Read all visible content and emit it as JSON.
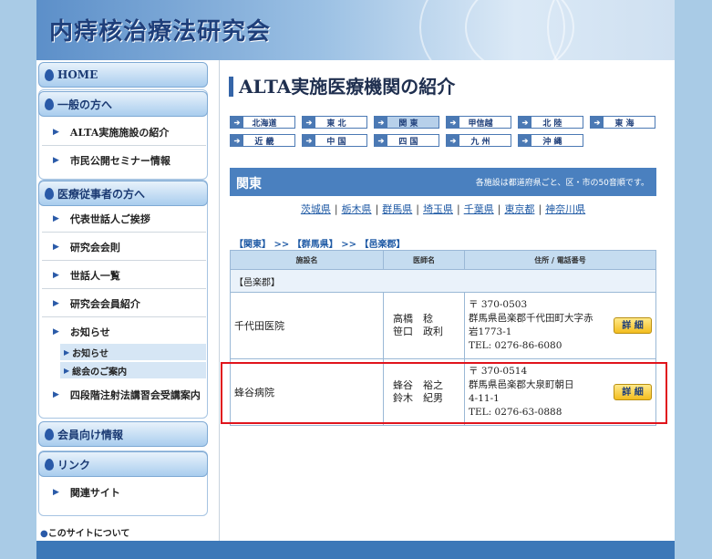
{
  "site": {
    "title": "内痔核治療法研究会"
  },
  "sidebar": {
    "home": "HOME",
    "general_heading": "一般の方へ",
    "general_items": [
      "ALTA実施施設の紹介",
      "市民公開セミナー情報"
    ],
    "medical_heading": "医療従事者の方へ",
    "medical_items": [
      "代表世話人ご挨拶",
      "研究会会則",
      "世話人一覧",
      "研究会会員紹介",
      "お知らせ"
    ],
    "news_sub": [
      "お知らせ",
      "総会のご案内"
    ],
    "medical_last": "四段階注射法講習会受講案内",
    "member_heading": "会員向け情報",
    "link_heading": "リンク",
    "link_items": [
      "関連サイト"
    ],
    "about": "このサイトについて"
  },
  "main": {
    "title": "ALTA実施医療機関の紹介",
    "regions": [
      {
        "label": "北海道",
        "active": false
      },
      {
        "label": "東 北",
        "active": false
      },
      {
        "label": "関 東",
        "active": true
      },
      {
        "label": "甲信越",
        "active": false
      },
      {
        "label": "北 陸",
        "active": false
      },
      {
        "label": "東 海",
        "active": false
      },
      {
        "label": "近 畿",
        "active": false
      },
      {
        "label": "中 国",
        "active": false
      },
      {
        "label": "四 国",
        "active": false
      },
      {
        "label": "九 州",
        "active": false
      },
      {
        "label": "沖 縄",
        "active": false
      }
    ],
    "region_name": "関東",
    "region_note": "各施設は都道府県ごと、区・市の50音順です。",
    "prefectures": [
      "茨城県",
      "栃木県",
      "群馬県",
      "埼玉県",
      "千葉県",
      "東京都",
      "神奈川県"
    ],
    "breadcrumb": [
      "【関東】",
      "【群馬県】",
      "【邑楽郡】"
    ],
    "breadcrumb_sep": ">>",
    "table": {
      "headers": [
        "施設名",
        "医師名",
        "住所 / 電話番号"
      ],
      "group": "【邑楽郡】",
      "rows": [
        {
          "facility": "千代田医院",
          "doctors": [
            "高橋　稔",
            "笹口　政利"
          ],
          "address": [
            "〒 370-0503",
            "群馬県邑楽郡千代田町大字赤",
            "岩1773-1",
            "TEL: 0276-86-6080"
          ],
          "detail": "詳 細"
        },
        {
          "facility": "蜂谷病院",
          "doctors": [
            "蜂谷　裕之",
            "鈴木　紀男"
          ],
          "address": [
            "〒 370-0514",
            "群馬県邑楽郡大泉町朝日",
            "4-11-1",
            "TEL: 0276-63-0888"
          ],
          "detail": "詳 細"
        }
      ]
    }
  },
  "colors": {
    "accent": "#3565a8",
    "highlight": "#e0141c",
    "detail_button": "#f3bd1e"
  },
  "icons": {
    "nav": "triangle-right-icon",
    "region": "arrow-right-icon",
    "heading": "drop-icon"
  }
}
